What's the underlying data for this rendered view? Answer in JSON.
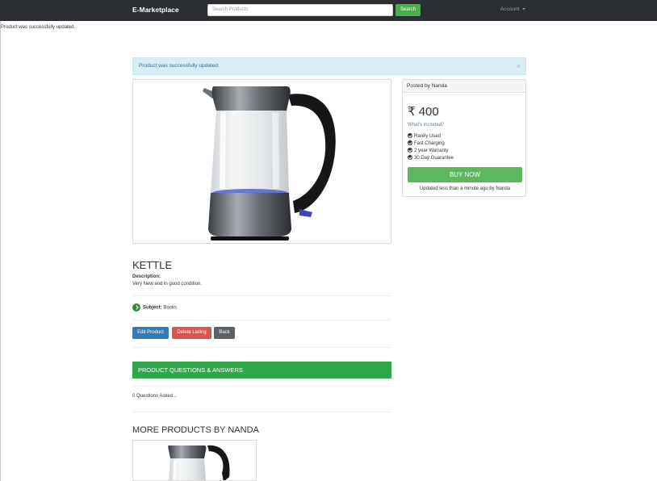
{
  "navbar": {
    "brand": "E-Marketplace",
    "search_placeholder": "Search Products",
    "search_button": "Search",
    "account_label": "Account"
  },
  "flash_top": "Product was successfully updated.",
  "alert": {
    "message": "Product was successfully updated.",
    "close": "×"
  },
  "product": {
    "title": "KETTLE",
    "description_label": "Description:",
    "description": "Very New and in good condition.",
    "subject_label": "Subject:",
    "subject_value": "Books",
    "image_icon": "kettle-image"
  },
  "side_panel": {
    "posted_by": "Posted by Nanda",
    "price": "₹ 400",
    "whats_included": "What's included?",
    "features": [
      "Rarely Used",
      "Fast Charging",
      "2 year Warranty",
      "30 Day Guarantee"
    ],
    "buy_button": "BUY NOW",
    "updated": "Updated less than a minute ago by Nanda"
  },
  "actions": {
    "edit": "Edit Product",
    "delete": "Delete Listing",
    "back": "Back"
  },
  "qa": {
    "header": "PRODUCT QUESTIONS & ANSWERS",
    "count": "0 Questions Asked..."
  },
  "more": {
    "title": "MORE PRODUCTS BY NANDA"
  },
  "colors": {
    "navbar": "#2b2e33",
    "success": "#5cb85c",
    "qa_header": "#2ea84a",
    "primary": "#337ab7",
    "danger": "#d9534f",
    "info_bg": "#d9edf7"
  }
}
